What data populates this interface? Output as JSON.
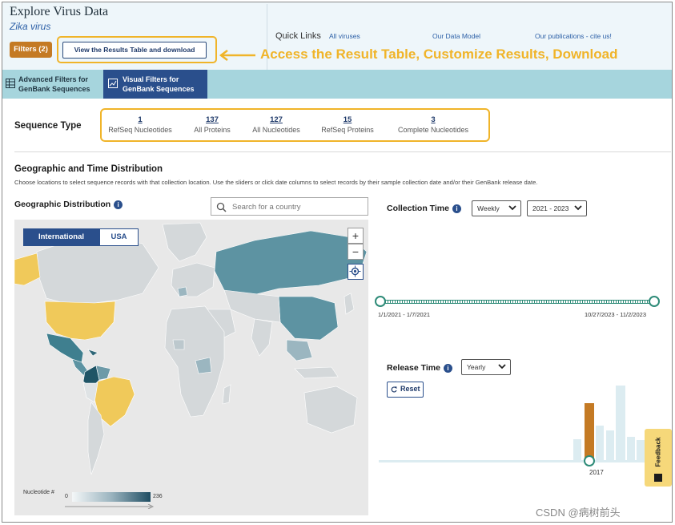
{
  "header": {
    "title": "Explore Virus Data",
    "subtitle": "Zika virus",
    "quick_links_label": "Quick Links",
    "quick_links": [
      "All viruses",
      "Our Data Model",
      "Our publications - cite us!"
    ],
    "filters_button": "Filters (2)",
    "results_button": "View the Results Table and download",
    "annotation": "Access the Result Table, Customize Results, Download"
  },
  "tabs": [
    {
      "label_line1": "Advanced Filters for",
      "label_line2": "GenBank Sequences",
      "icon": "table-icon",
      "active": false
    },
    {
      "label_line1": "Visual Filters for",
      "label_line2": "GenBank Sequences",
      "icon": "chart-icon",
      "active": true
    }
  ],
  "sequence_type": {
    "label": "Sequence Type",
    "items": [
      {
        "count": "1",
        "name": "RefSeq Nucleotides"
      },
      {
        "count": "137",
        "name": "All Proteins"
      },
      {
        "count": "127",
        "name": "All Nucleotides"
      },
      {
        "count": "15",
        "name": "RefSeq Proteins"
      },
      {
        "count": "3",
        "name": "Complete Nucleotides"
      }
    ]
  },
  "geo": {
    "title": "Geographic and Time Distribution",
    "description": "Choose locations to select sequence records with that collection location. Use the sliders or click date columns to select records by their sample collection date and/or their GenBank release date.",
    "dist_label": "Geographic Distribution",
    "search_placeholder": "Search for a country",
    "toggle_international": "International",
    "toggle_usa": "USA",
    "zoom_in": "+",
    "zoom_out": "−",
    "legend_label": "Nucleotide #",
    "legend_min": "0",
    "legend_max": "236"
  },
  "collection": {
    "label": "Collection Time",
    "interval": "Weekly",
    "range": "2021 - 2023",
    "start_label": "1/1/2021 - 1/7/2021",
    "end_label": "10/27/2023 - 11/2/2023"
  },
  "release": {
    "label": "Release Time",
    "interval": "Yearly",
    "reset": "Reset",
    "selected_year": "2017"
  },
  "feedback": "Feedback",
  "watermark": "CSDN @病树前头",
  "colors": {
    "accent_navy": "#2a4f8c",
    "orange": "#c47a24",
    "highlight_yellow": "#f0b429",
    "teal": "#2e8b78",
    "tab_bar": "#a6d5dd"
  }
}
